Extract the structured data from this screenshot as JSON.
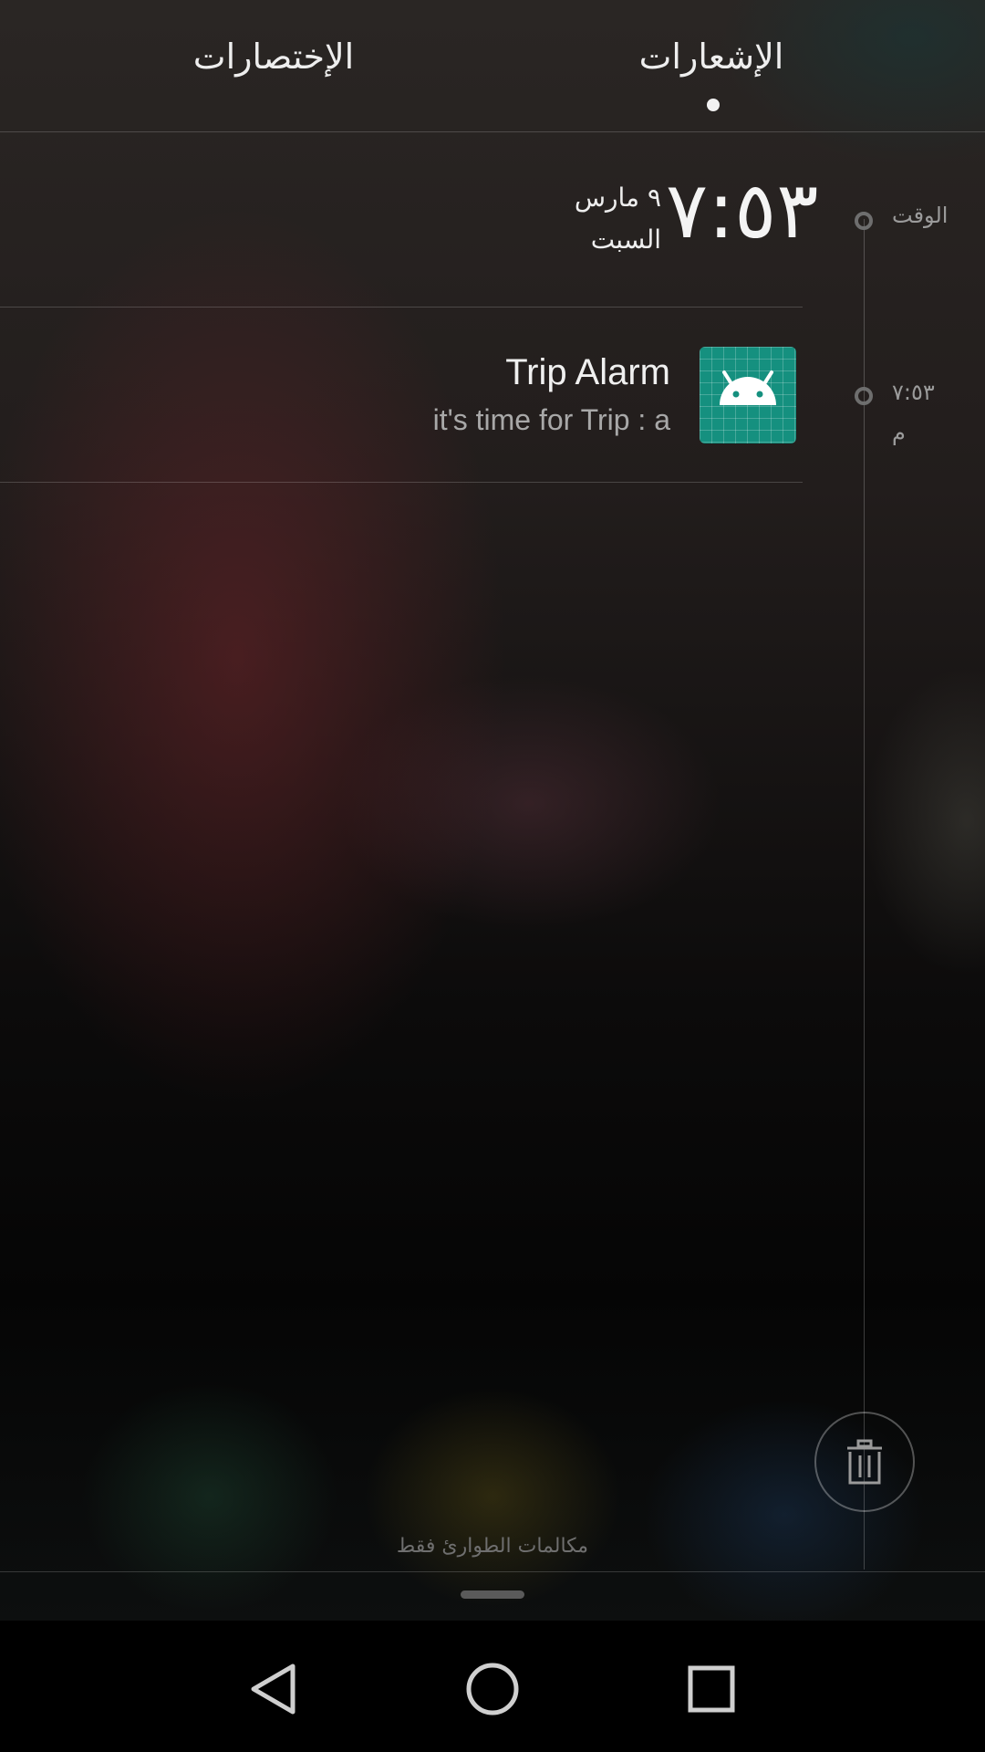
{
  "tabs": {
    "notifications": "الإشعارات",
    "shortcuts": "الإختصارات"
  },
  "timeline": {
    "time_label": "الوقت",
    "notif_time": "٧:٥٣",
    "notif_ampm": "م"
  },
  "clock": {
    "time": "٧:٥٣",
    "date_line1": "٩ مارس",
    "date_line2": "السبت"
  },
  "notification": {
    "title": "Trip Alarm",
    "text": "it's time for Trip : a",
    "app_icon": "android-robot-icon"
  },
  "footer": {
    "status_text": "مكالمات الطوارئ فقط"
  },
  "icons": {
    "trash": "trash-icon",
    "back": "back-triangle-icon",
    "home": "home-circle-icon",
    "recents": "recents-square-icon"
  },
  "colors": {
    "app_icon_bg": "#15907f"
  }
}
